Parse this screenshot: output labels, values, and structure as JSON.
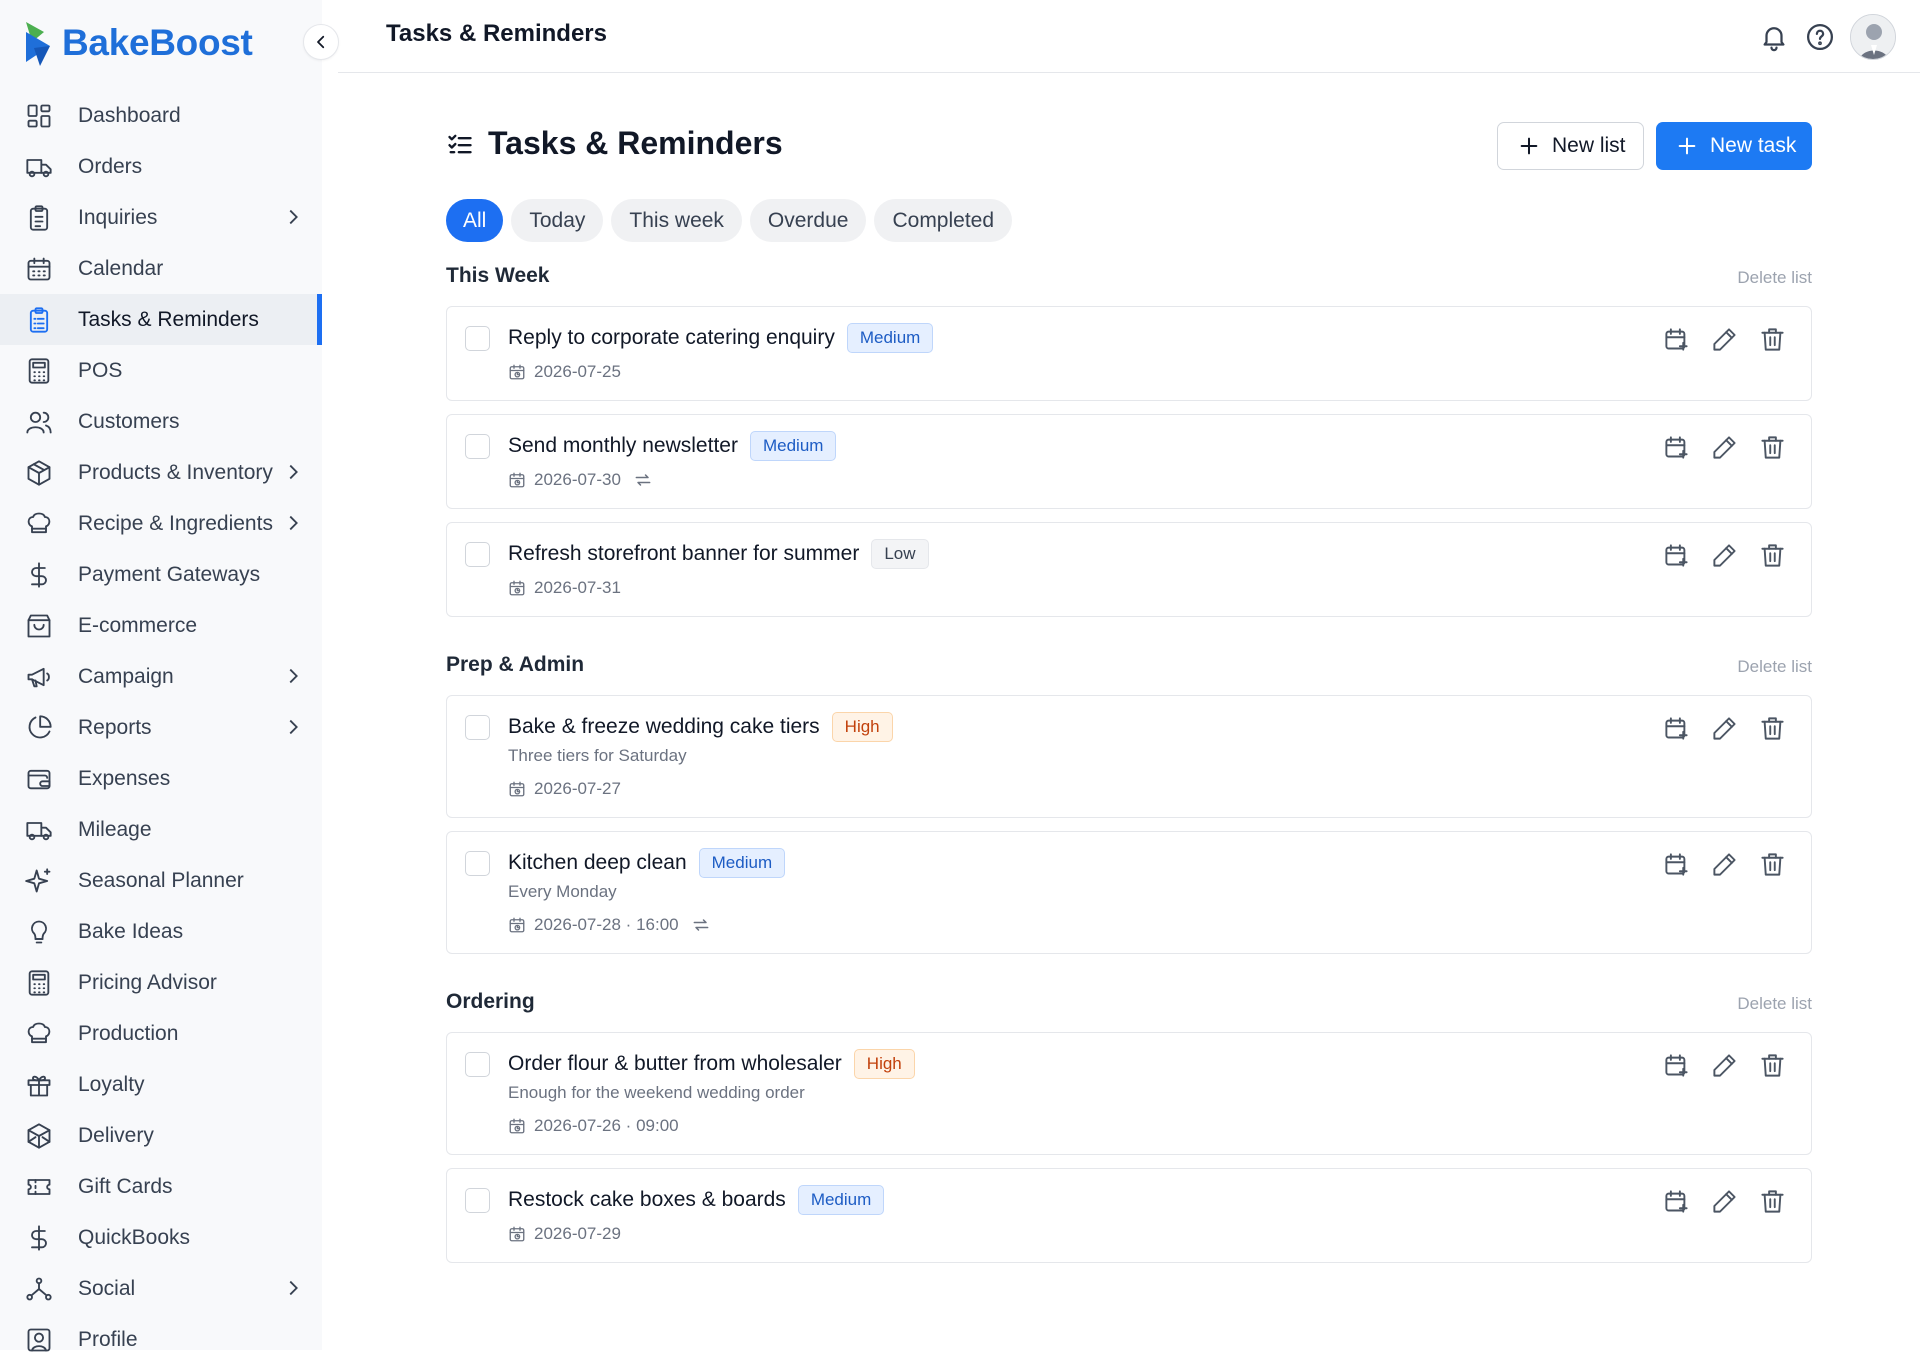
{
  "brand": {
    "name": "BakeBoost"
  },
  "sidebar": {
    "items": [
      {
        "label": "Dashboard",
        "icon": "dashboard-icon"
      },
      {
        "label": "Orders",
        "icon": "truck-icon"
      },
      {
        "label": "Inquiries",
        "icon": "clipboard-icon",
        "has_submenu": true
      },
      {
        "label": "Calendar",
        "icon": "calendar-icon"
      },
      {
        "label": "Tasks & Reminders",
        "icon": "tasks-icon",
        "active": true
      },
      {
        "label": "POS",
        "icon": "calculator-icon"
      },
      {
        "label": "Customers",
        "icon": "users-icon"
      },
      {
        "label": "Products & Inventory",
        "icon": "box-icon",
        "has_submenu": true
      },
      {
        "label": "Recipe & Ingredients",
        "icon": "chef-hat-icon",
        "has_submenu": true
      },
      {
        "label": "Payment Gateways",
        "icon": "dollar-icon"
      },
      {
        "label": "E-commerce",
        "icon": "shopping-bag-icon"
      },
      {
        "label": "Campaign",
        "icon": "megaphone-icon",
        "has_submenu": true
      },
      {
        "label": "Reports",
        "icon": "pie-chart-icon",
        "has_submenu": true
      },
      {
        "label": "Expenses",
        "icon": "wallet-icon"
      },
      {
        "label": "Mileage",
        "icon": "truck-icon"
      },
      {
        "label": "Seasonal Planner",
        "icon": "sparkles-icon"
      },
      {
        "label": "Bake Ideas",
        "icon": "lightbulb-icon"
      },
      {
        "label": "Pricing Advisor",
        "icon": "calculator-icon"
      },
      {
        "label": "Production",
        "icon": "chef-hat-icon"
      },
      {
        "label": "Loyalty",
        "icon": "gift-icon"
      },
      {
        "label": "Delivery",
        "icon": "package-icon"
      },
      {
        "label": "Gift Cards",
        "icon": "ticket-icon"
      },
      {
        "label": "QuickBooks",
        "icon": "dollar-icon"
      },
      {
        "label": "Social",
        "icon": "network-icon",
        "has_submenu": true
      },
      {
        "label": "Profile",
        "icon": "profile-icon"
      }
    ]
  },
  "header": {
    "title": "Tasks & Reminders"
  },
  "page": {
    "title": "Tasks & Reminders",
    "new_list_label": "New list",
    "new_task_label": "New task",
    "tabs": [
      {
        "label": "All",
        "active": true
      },
      {
        "label": "Today"
      },
      {
        "label": "This week"
      },
      {
        "label": "Overdue"
      },
      {
        "label": "Completed"
      }
    ]
  },
  "lists": [
    {
      "title": "This Week",
      "delete_label": "Delete list",
      "tasks": [
        {
          "title": "Reply to corporate catering enquiry",
          "priority": "Medium",
          "date": "2026-07-25"
        },
        {
          "title": "Send monthly newsletter",
          "priority": "Medium",
          "date": "2026-07-30",
          "recurring": true
        },
        {
          "title": "Refresh storefront banner for summer",
          "priority": "Low",
          "date": "2026-07-31"
        }
      ]
    },
    {
      "title": "Prep & Admin",
      "delete_label": "Delete list",
      "tasks": [
        {
          "title": "Bake & freeze wedding cake tiers",
          "priority": "High",
          "note": "Three tiers for Saturday",
          "date": "2026-07-27"
        },
        {
          "title": "Kitchen deep clean",
          "priority": "Medium",
          "note": "Every Monday",
          "date": "2026-07-28 · 16:00",
          "recurring": true
        }
      ]
    },
    {
      "title": "Ordering",
      "delete_label": "Delete list",
      "tasks": [
        {
          "title": "Order flour & butter from wholesaler",
          "priority": "High",
          "note": "Enough for the weekend wedding order",
          "date": "2026-07-26 · 09:00"
        },
        {
          "title": "Restock cake boxes & boards",
          "priority": "Medium",
          "date": "2026-07-29"
        }
      ]
    }
  ],
  "colors": {
    "accent": "#1d6ff2",
    "brand": "#1f6fd9",
    "logo_green": "#4caf50",
    "logo_blue": "#1f6fd9"
  }
}
